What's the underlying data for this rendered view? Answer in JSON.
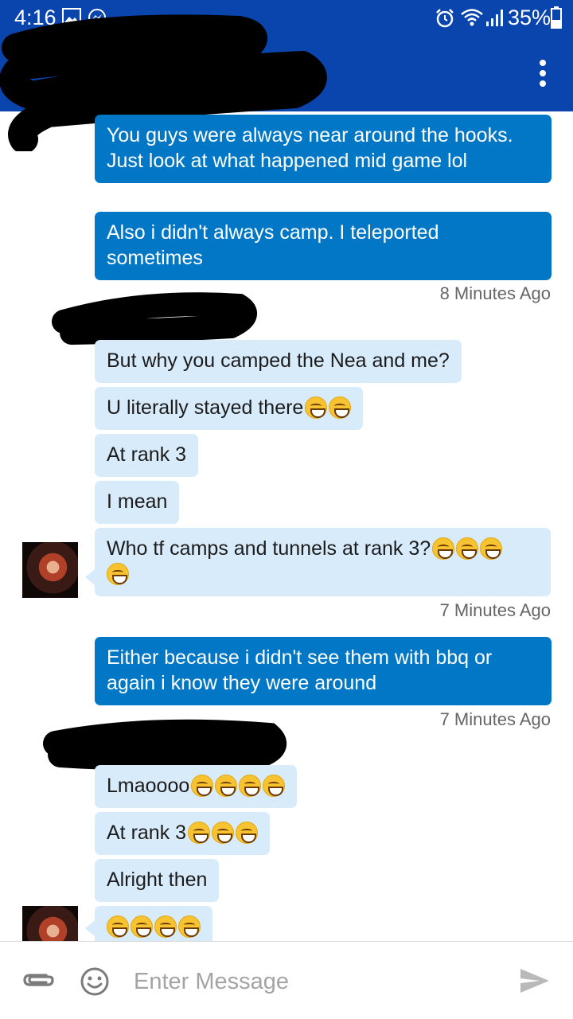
{
  "status_bar": {
    "time": "4:16",
    "battery": "35%",
    "icons": [
      "gallery-icon",
      "messenger-icon",
      "alarm-icon",
      "wifi-icon",
      "signal-icon",
      "battery-icon"
    ]
  },
  "app_bar": {
    "menu_icon": "more-vert-icon"
  },
  "messages": [
    {
      "side": "out",
      "text": "You guys were always near around the hooks. Just look at what happened mid game lol"
    },
    {
      "side": "out",
      "text": "Also i didn't always camp. I teleported sometimes"
    },
    {
      "side": "in",
      "text": "But why you camped the Nea and me?"
    },
    {
      "side": "in",
      "text": "U literally stayed there",
      "emoji_count": 2
    },
    {
      "side": "in",
      "text": "At rank 3"
    },
    {
      "side": "in",
      "text": "I mean"
    },
    {
      "side": "in",
      "text": "Who tf camps and tunnels at rank 3?",
      "emoji_count": 4
    },
    {
      "side": "out",
      "text": "Either because i didn't see them with bbq or again i know they were around"
    },
    {
      "side": "in",
      "text": "Lmaoooo",
      "emoji_count": 4
    },
    {
      "side": "in",
      "text": "At rank 3",
      "emoji_count": 3
    },
    {
      "side": "in",
      "text": "Alright then"
    },
    {
      "side": "in",
      "text": "",
      "emoji_count": 4
    }
  ],
  "timestamps": {
    "t1": "8 Minutes Ago",
    "t2": "7 Minutes Ago",
    "t3": "7 Minutes Ago"
  },
  "emoji_name": "grinning-squinting-face",
  "composer": {
    "placeholder": "Enter Message",
    "attach_icon": "paperclip-icon",
    "emoji_icon": "smiley-icon",
    "send_icon": "send-icon"
  },
  "colors": {
    "header": "#0a44ad",
    "outgoing_bubble": "#0277c6",
    "incoming_bubble": "#d8ebfa"
  }
}
